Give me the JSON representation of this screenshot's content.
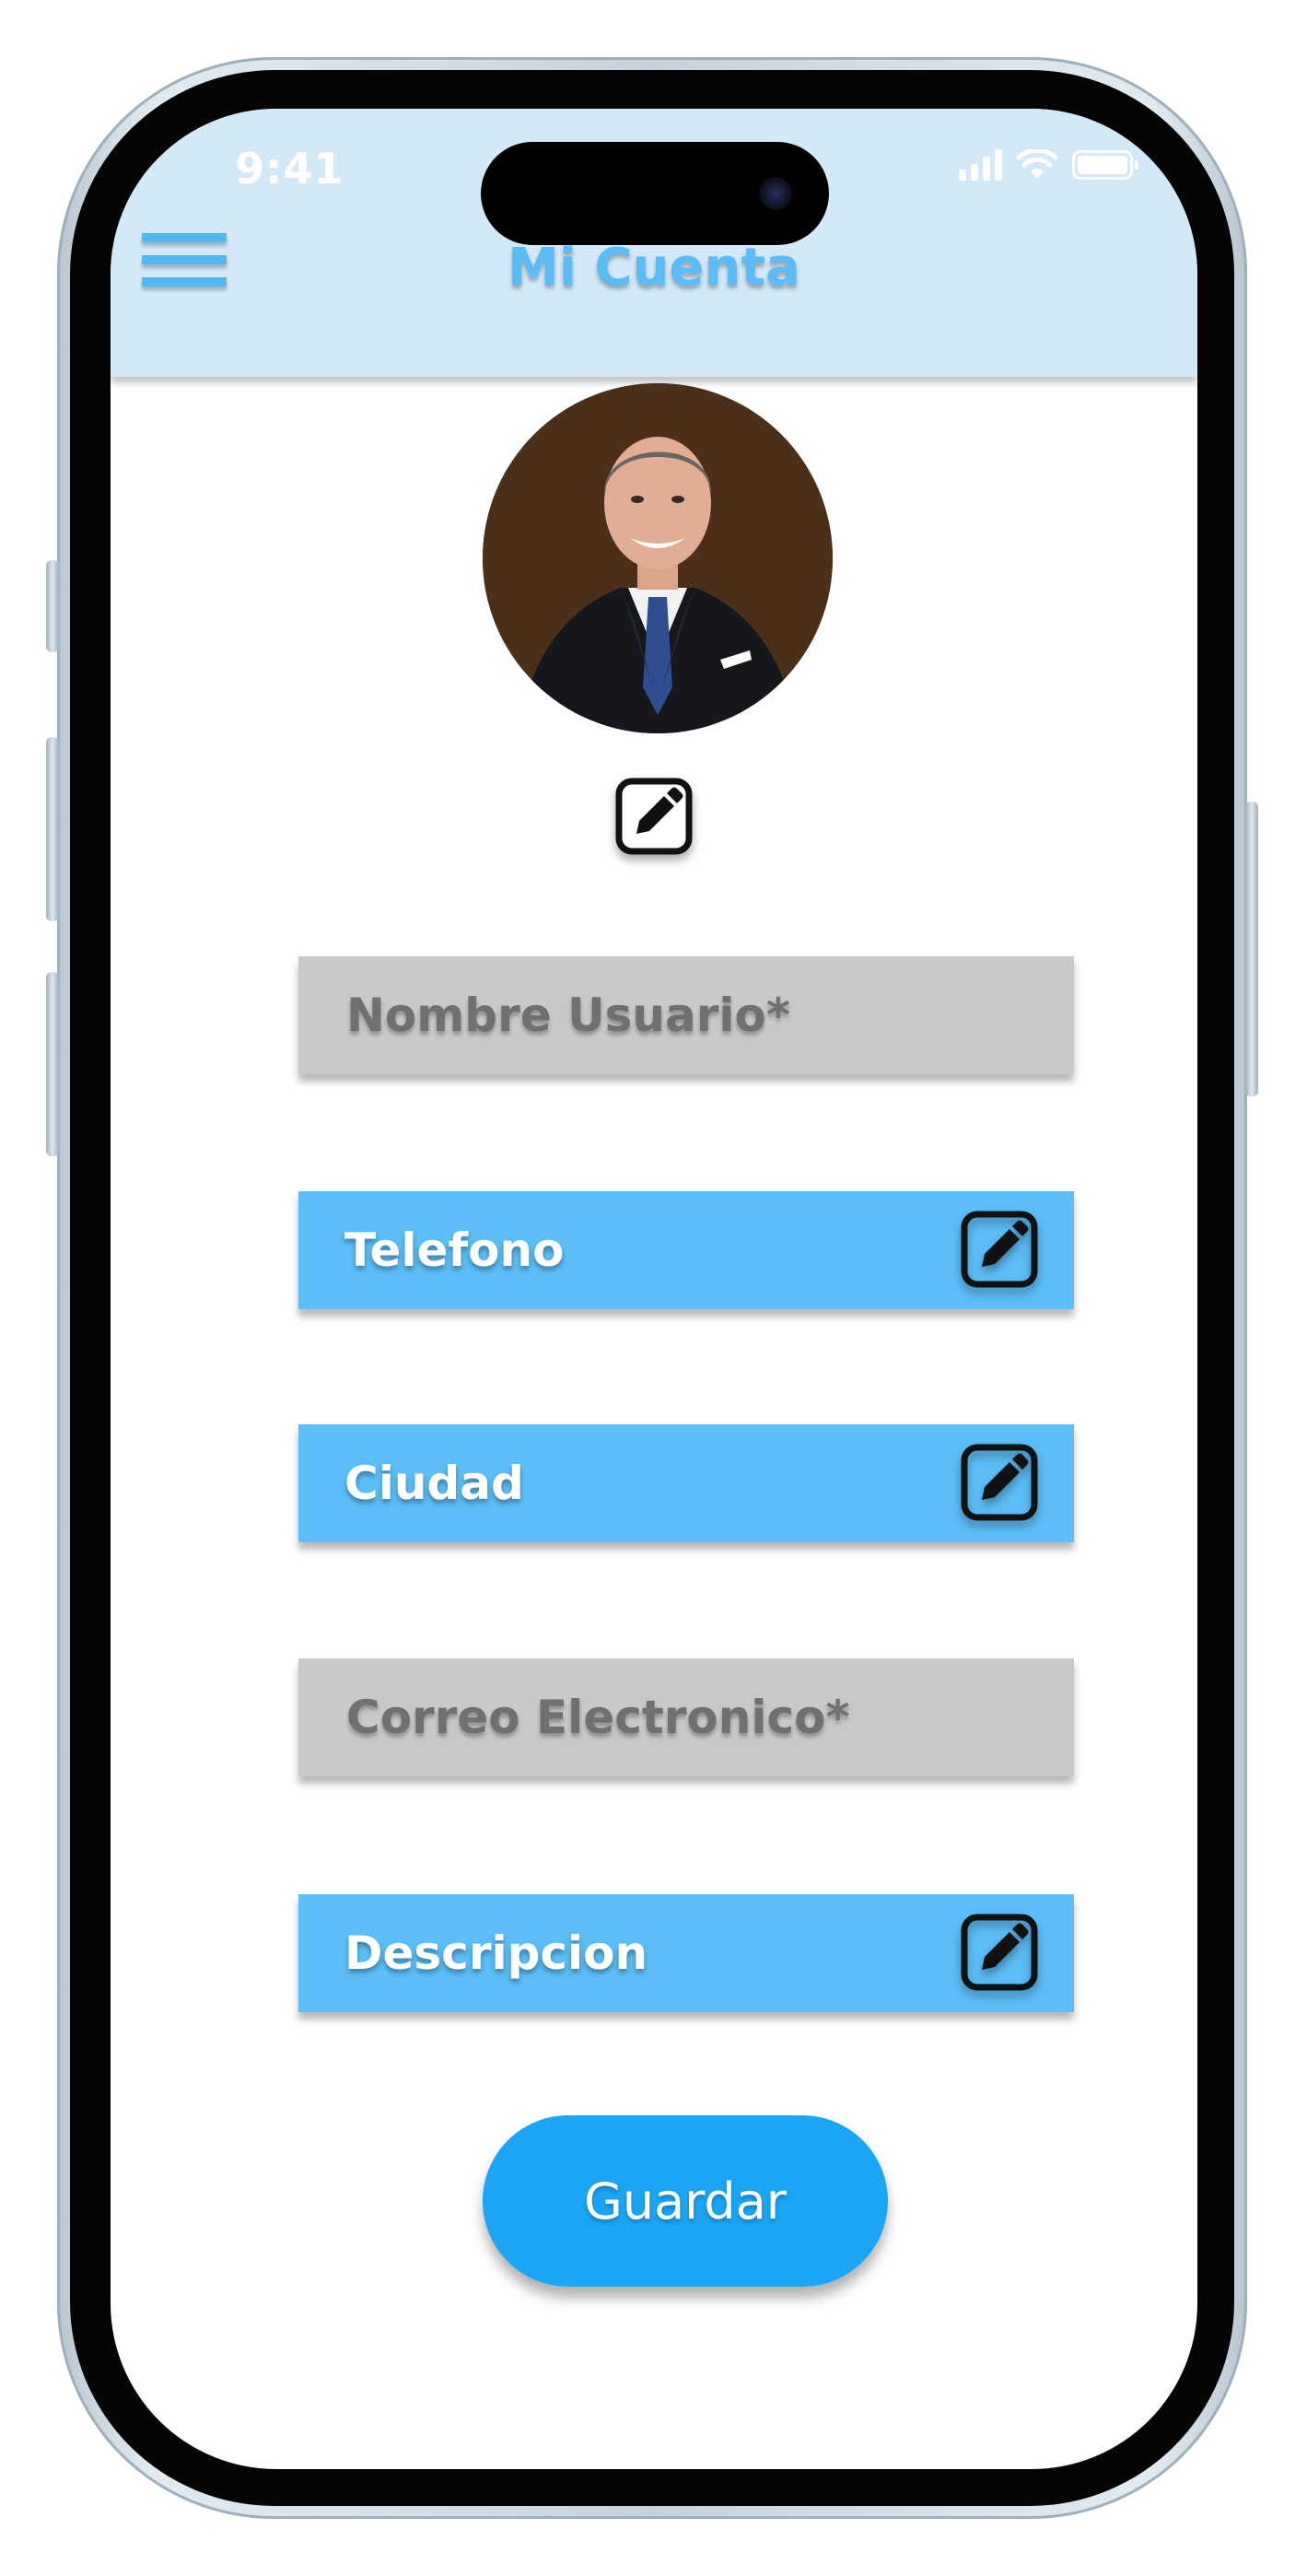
{
  "status_bar": {
    "time": "9:41"
  },
  "header": {
    "title": "Mi Cuenta",
    "menu_icon": "hamburger-menu-icon"
  },
  "profile": {
    "avatar": "avatar-photo",
    "edit_icon": "edit-icon"
  },
  "form": {
    "username": {
      "placeholder": "Nombre Usuario*"
    },
    "phone": {
      "label": "Telefono"
    },
    "city": {
      "label": "Ciudad"
    },
    "email": {
      "placeholder": "Correo Electronico*"
    },
    "description": {
      "label": "Descripcion"
    }
  },
  "actions": {
    "save_label": "Guardar"
  },
  "colors": {
    "header_bg": "#d4e9f8",
    "accent": "#5cbff9",
    "title": "#5bbcf6",
    "button": "#1aa6f4",
    "input_gray": "#c9c9c9"
  }
}
